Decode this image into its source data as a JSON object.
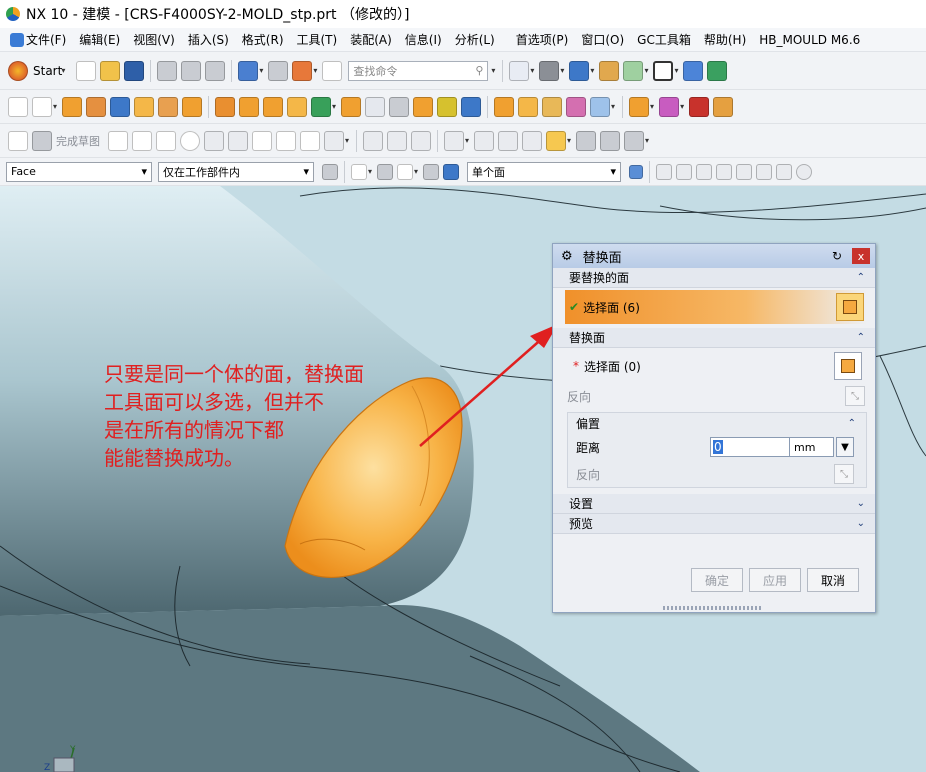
{
  "window": {
    "title": "NX 10 - 建模 - [CRS-F4000SY-2-MOLD_stp.prt （修改的）]"
  },
  "menu": [
    "文件(F)",
    "编辑(E)",
    "视图(V)",
    "插入(S)",
    "格式(R)",
    "工具(T)",
    "装配(A)",
    "信息(I)",
    "分析(L)",
    "首选项(P)",
    "窗口(O)",
    "GC工具箱",
    "帮助(H)",
    "HB_MOULD M6.6"
  ],
  "toolbar1": {
    "start_label": "Start",
    "search_placeholder": "查找命令"
  },
  "toolbar3": {
    "finish_sketch_label": "完成草图"
  },
  "selection_bar": {
    "filter": "Face",
    "scope": "仅在工作部件内",
    "face_rule": "单个面"
  },
  "annotation": {
    "text": "只要是同一个体的面，替换面\n工具面可以多选，但并不\n是在所有的情况下都\n能能替换成功。",
    "color": "#e02020"
  },
  "dialog": {
    "title": "替换面",
    "group_target": "要替换的面",
    "select_target": "选择面 (6)",
    "group_tool": "替换面",
    "select_tool": "选择面 (0)",
    "reverse1": "反向",
    "offset_group": "偏置",
    "distance_label": "距离",
    "distance_value": "0",
    "distance_unit": "mm",
    "reverse2": "反向",
    "settings": "设置",
    "preview": "预览",
    "ok": "确定",
    "apply": "应用",
    "cancel": "取消"
  },
  "colors": {
    "highlight": "#f5a940",
    "viewport_bg": "#c4dce4",
    "annotation": "#e02020"
  }
}
